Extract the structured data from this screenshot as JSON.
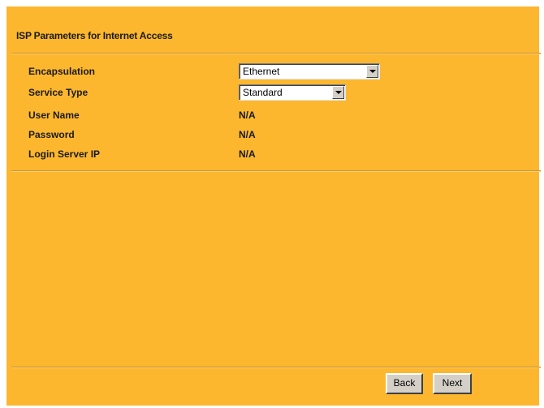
{
  "page": {
    "title": "ISP Parameters for Internet Access"
  },
  "fields": {
    "encapsulation": {
      "label": "Encapsulation",
      "value": "Ethernet"
    },
    "service_type": {
      "label": "Service Type",
      "value": "Standard"
    },
    "user_name": {
      "label": "User Name",
      "value": "N/A"
    },
    "password": {
      "label": "Password",
      "value": "N/A"
    },
    "login_server_ip": {
      "label": "Login Server IP",
      "value": "N/A"
    }
  },
  "buttons": {
    "back": "Back",
    "next": "Next"
  },
  "colors": {
    "panel_background": "#fcb72f"
  }
}
